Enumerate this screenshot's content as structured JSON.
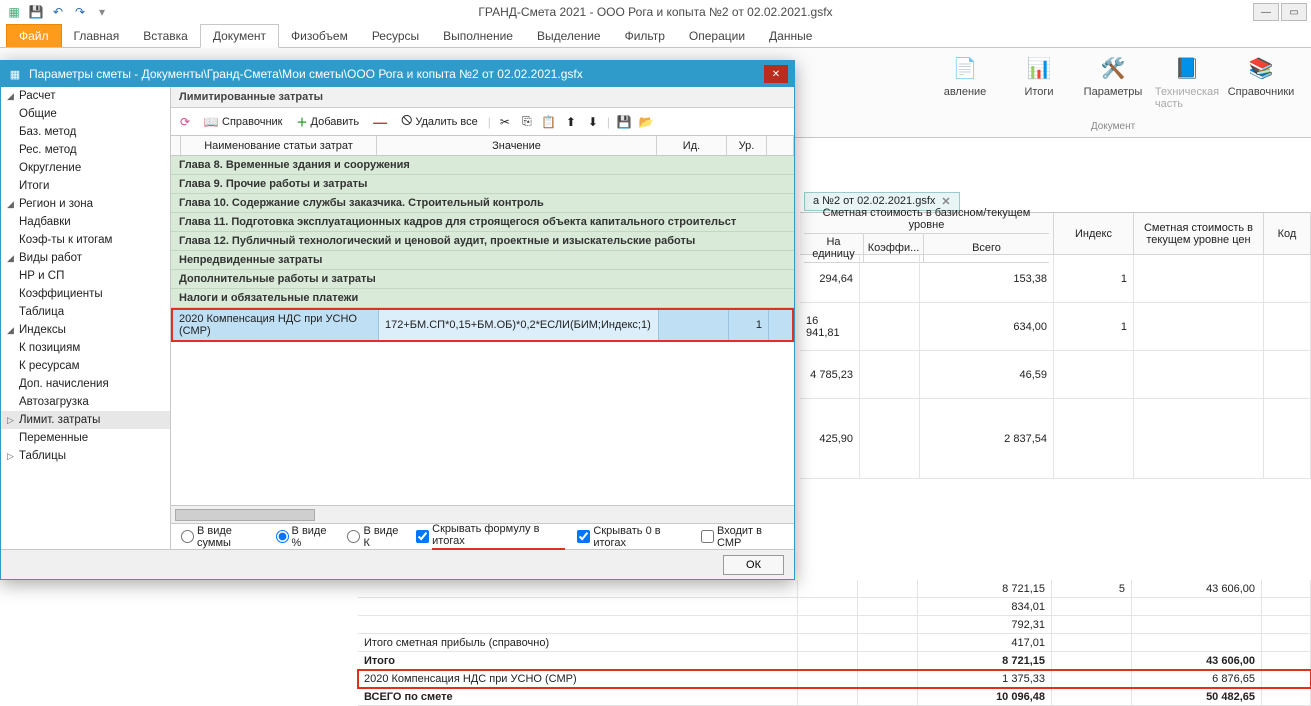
{
  "app_title": "ГРАНД-Смета 2021 - ООО Рога и копыта №2 от 02.02.2021.gsfx",
  "ribbon_tabs": {
    "file": "Файл",
    "main": "Главная",
    "insert": "Вставка",
    "doc": "Документ",
    "phys": "Физобъем",
    "res": "Ресурсы",
    "exec": "Выполнение",
    "select": "Выделение",
    "filter": "Фильтр",
    "oper": "Операции",
    "data": "Данные"
  },
  "ribbon": {
    "group_doc": "Документ",
    "btn_oglav": "авление",
    "btn_itogi": "Итоги",
    "btn_params": "Параметры",
    "btn_tech": "Техническая часть",
    "btn_sprav": "Справочники"
  },
  "doc_tab": "а №2 от 02.02.2021.gsfx",
  "tree": {
    "calc": "Расчет",
    "common": "Общие",
    "baz": "Баз. метод",
    "res": "Рес. метод",
    "round": "Округление",
    "itogi": "Итоги",
    "region": "Регион и зона",
    "nadbavki": "Надбавки",
    "koef_it": "Коэф-ты к итогам",
    "vidy": "Виды работ",
    "nrsp": "НР и СП",
    "koef": "Коэффициенты",
    "tabl": "Таблица",
    "indexes": "Индексы",
    "kpoz": "К позициям",
    "kres": "К ресурсам",
    "dopn": "Доп. начисления",
    "auto": "Автозагрузка",
    "limit": "Лимит. затраты",
    "perem": "Переменные",
    "tabls": "Таблицы"
  },
  "dialog": {
    "title": "Параметры сметы - Документы\\Гранд-Смета\\Мои сметы\\ООО Рога и копыта №2 от 02.02.2021.gsfx",
    "section": "Лимитированные затраты",
    "tb": {
      "sprav": "Справочник",
      "add": "Добавить",
      "delall": "Удалить все"
    },
    "hdr": {
      "name": "Наименование статьи затрат",
      "val": "Значение",
      "id": "Ид.",
      "lvl": "Ур."
    },
    "rows": {
      "g8": "Глава 8. Временные здания и сооружения",
      "g9": "Глава 9. Прочие работы и затраты",
      "g10": "Глава 10. Содержание службы заказчика. Строительный контроль",
      "g11": "Глава 11. Подготовка эксплуатационных кадров для строящегося объекта капитального строительст",
      "g12": "Глава 12. Публичный технологический и ценовой аудит, проектные и изыскательские работы",
      "nep": "Непредвиденные затраты",
      "dop": "Дополнительные работы и затраты",
      "nal": "Налоги и обязательные платежи"
    },
    "sel": {
      "name": "2020 Компенсация НДС при УСНО (СМР)",
      "val": "172+БМ.СП*0,15+БМ.ОБ)*0,2*ЕСЛИ(БИМ;Индекс;1)",
      "lvl": "1"
    },
    "opts": {
      "sum": "В виде суммы",
      "pct": "В виде %",
      "k": "В виде К",
      "hidefml": "Скрывать формулу в итогах",
      "hide0": "Скрывать 0 в итогах",
      "smr": "Входит в СМР"
    },
    "ok": "ОК"
  },
  "bg": {
    "head": {
      "span": "Сметная стоимость в базисном/текущем уровне",
      "ed": "На единицу",
      "koef": "Коэффи...",
      "total": "Всего",
      "index": "Индекс",
      "cur": "Сметная стоимость в текущем уровне цен",
      "kod": "Код"
    },
    "rows": [
      {
        "ed": "294,64",
        "total": "153,38",
        "index": "1"
      },
      {
        "ed": "16 941,81",
        "total": "634,00",
        "index": "1"
      },
      {
        "ed": "4 785,23",
        "total": "46,59"
      },
      {
        "ed": "425,90",
        "total": "2 837,54"
      }
    ]
  },
  "bottom": {
    "r1": {
      "total": "8 721,15",
      "index": "5",
      "cur": "43 606,00"
    },
    "r2": {
      "total": "834,01"
    },
    "r3": {
      "total": "792,31"
    },
    "r4": {
      "label": "Итого сметная прибыль (справочно)",
      "total": "417,01"
    },
    "r5": {
      "label": "Итого",
      "total": "8 721,15",
      "cur": "43 606,00"
    },
    "r6": {
      "label": "2020 Компенсация НДС при УСНО (СМР)",
      "total": "1 375,33",
      "cur": "6 876,65"
    },
    "r7": {
      "label": "ВСЕГО по смете",
      "total": "10 096,48",
      "cur": "50 482,65"
    }
  }
}
